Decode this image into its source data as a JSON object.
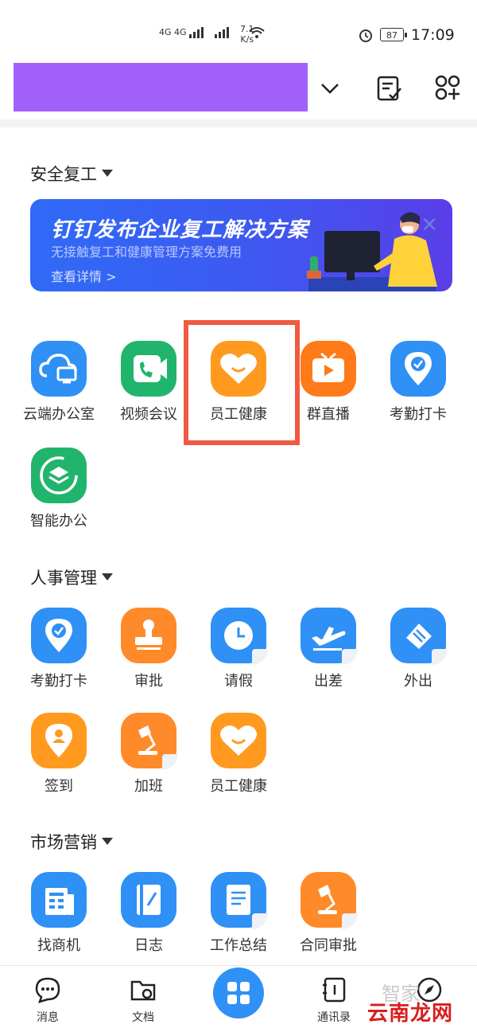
{
  "status_bar": {
    "network": "4G 4G",
    "speed_value": "7.1",
    "speed_unit": "K/s",
    "battery": "87",
    "time": "17:09"
  },
  "header": {
    "brand_color": "#a161fa",
    "icons": [
      "chevron-down-icon",
      "checklist-icon",
      "apps-add-icon"
    ]
  },
  "sections": [
    {
      "title": "安全复工",
      "banner": {
        "title": "钉钉发布企业复工解决方案",
        "subtitle": "无接触复工和健康管理方案免费用",
        "link": "查看详情 >"
      },
      "apps": [
        {
          "label": "云端办公室",
          "icon": "cloud-office-icon",
          "color": "#2f90f5"
        },
        {
          "label": "视频会议",
          "icon": "video-call-icon",
          "color": "#21b46c"
        },
        {
          "label": "员工健康",
          "icon": "heart-smile-icon",
          "color": "#ff9a1f",
          "highlighted": true
        },
        {
          "label": "群直播",
          "icon": "live-tv-icon",
          "color": "#ff7a18"
        },
        {
          "label": "考勤打卡",
          "icon": "location-check-icon",
          "color": "#2f90f5"
        },
        {
          "label": "智能办公",
          "icon": "layers-icon",
          "color": "#21b46c"
        }
      ]
    },
    {
      "title": "人事管理",
      "apps": [
        {
          "label": "考勤打卡",
          "icon": "location-check-icon",
          "color": "#2f90f5"
        },
        {
          "label": "审批",
          "icon": "stamp-icon",
          "color": "#ff8a2a"
        },
        {
          "label": "请假",
          "icon": "clock-icon",
          "color": "#2f90f5"
        },
        {
          "label": "出差",
          "icon": "airplane-icon",
          "color": "#2f90f5"
        },
        {
          "label": "外出",
          "icon": "outing-icon",
          "color": "#2f90f5"
        },
        {
          "label": "签到",
          "icon": "location-person-icon",
          "color": "#ff9a1f"
        },
        {
          "label": "加班",
          "icon": "desk-lamp-icon",
          "color": "#ff8a2a"
        },
        {
          "label": "员工健康",
          "icon": "heart-smile-icon",
          "color": "#ff9a1f"
        }
      ]
    },
    {
      "title": "市场营销",
      "apps": [
        {
          "label": "找商机",
          "icon": "building-icon",
          "color": "#2f90f5"
        },
        {
          "label": "日志",
          "icon": "journal-icon",
          "color": "#2f90f5"
        },
        {
          "label": "工作总结",
          "icon": "document-icon",
          "color": "#2f90f5"
        },
        {
          "label": "合同审批",
          "icon": "desk-lamp-icon",
          "color": "#ff8a2a"
        }
      ]
    }
  ],
  "bottom_nav": [
    {
      "label": "消息",
      "icon": "chat-icon"
    },
    {
      "label": "文档",
      "icon": "folder-icon"
    },
    {
      "label": "",
      "icon": "workbench-grid-icon"
    },
    {
      "label": "通讯录",
      "icon": "contacts-icon"
    },
    {
      "label": "",
      "icon": "compass-icon"
    }
  ],
  "watermark": {
    "text": "云南龙网",
    "faint": "智家"
  }
}
